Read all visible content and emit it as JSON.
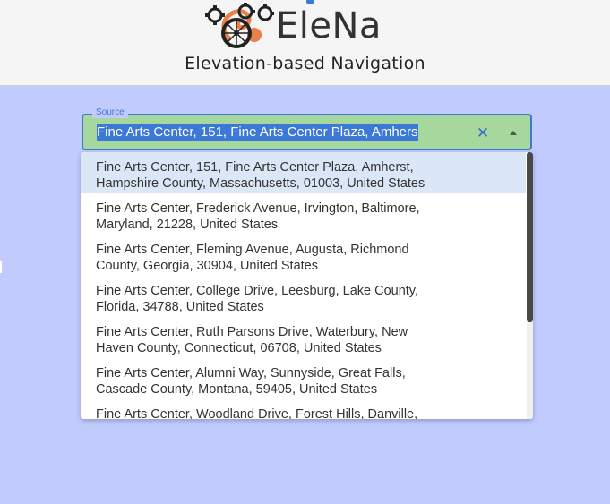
{
  "header": {
    "brand": "EleNa",
    "tagline": "Elevation-based Navigation",
    "logo_icon": "bicycle-gears-icon"
  },
  "source": {
    "label": "Source",
    "value": "Fine Arts Center, 151, Fine Arts Center Plaza, Amhers",
    "clear_icon": "close-icon",
    "popup_icon": "caret-up-icon"
  },
  "options": [
    {
      "line1": "Fine Arts Center, 151, Fine Arts Center Plaza, Amherst,",
      "line2": "Hampshire County, Massachusetts, 01003, United States"
    },
    {
      "line1": "Fine Arts Center, Frederick Avenue, Irvington, Baltimore,",
      "line2": "Maryland, 21228, United States"
    },
    {
      "line1": "Fine Arts Center, Fleming Avenue, Augusta, Richmond",
      "line2": "County, Georgia, 30904, United States"
    },
    {
      "line1": "Fine Arts Center, College Drive, Leesburg, Lake County,",
      "line2": "Florida, 34788, United States"
    },
    {
      "line1": "Fine Arts Center, Ruth Parsons Drive, Waterbury, New",
      "line2": "Haven County, Connecticut, 06708, United States"
    },
    {
      "line1": "Fine Arts Center, Alumni Way, Sunnyside, Great Falls,",
      "line2": "Cascade County, Montana, 59405, United States"
    },
    {
      "line1": "Fine Arts Center, Woodland Drive, Forest Hills, Danville,",
      "line2": ""
    }
  ],
  "colors": {
    "page_bg": "#c2cbfe",
    "accent": "#3b78d8",
    "field_bg": "#a6d89e",
    "logo_orange": "#e8804a"
  }
}
